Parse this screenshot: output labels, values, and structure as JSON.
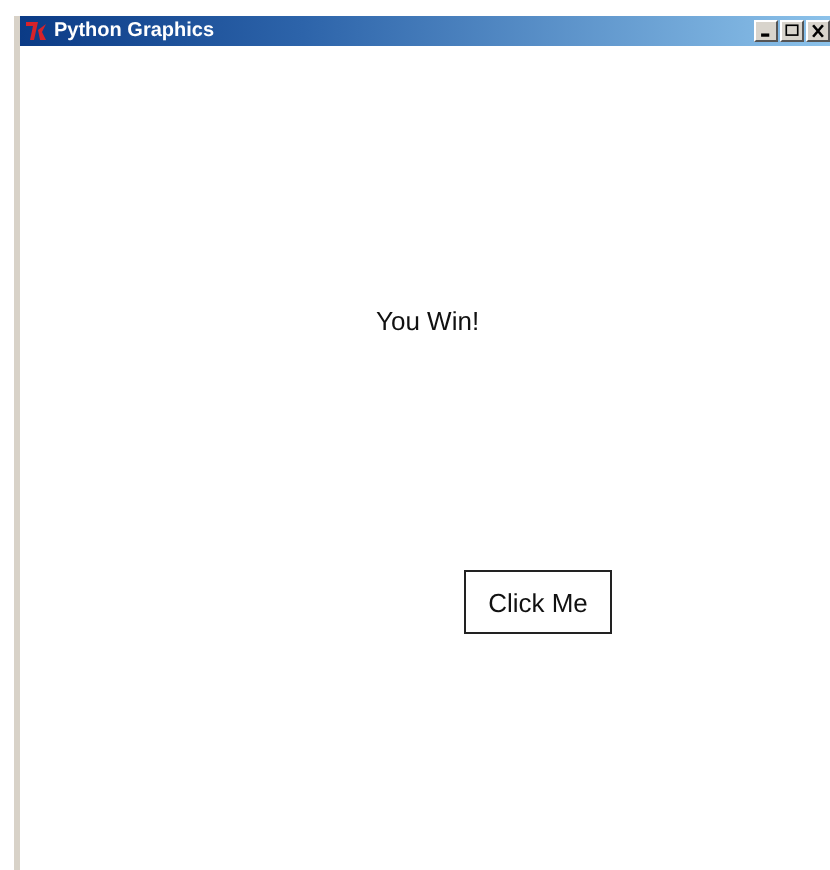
{
  "window": {
    "title": "Python Graphics"
  },
  "canvas": {
    "items": [
      {
        "kind": "text",
        "text": "You Win!"
      },
      {
        "kind": "button",
        "text": "Click Me"
      }
    ]
  }
}
